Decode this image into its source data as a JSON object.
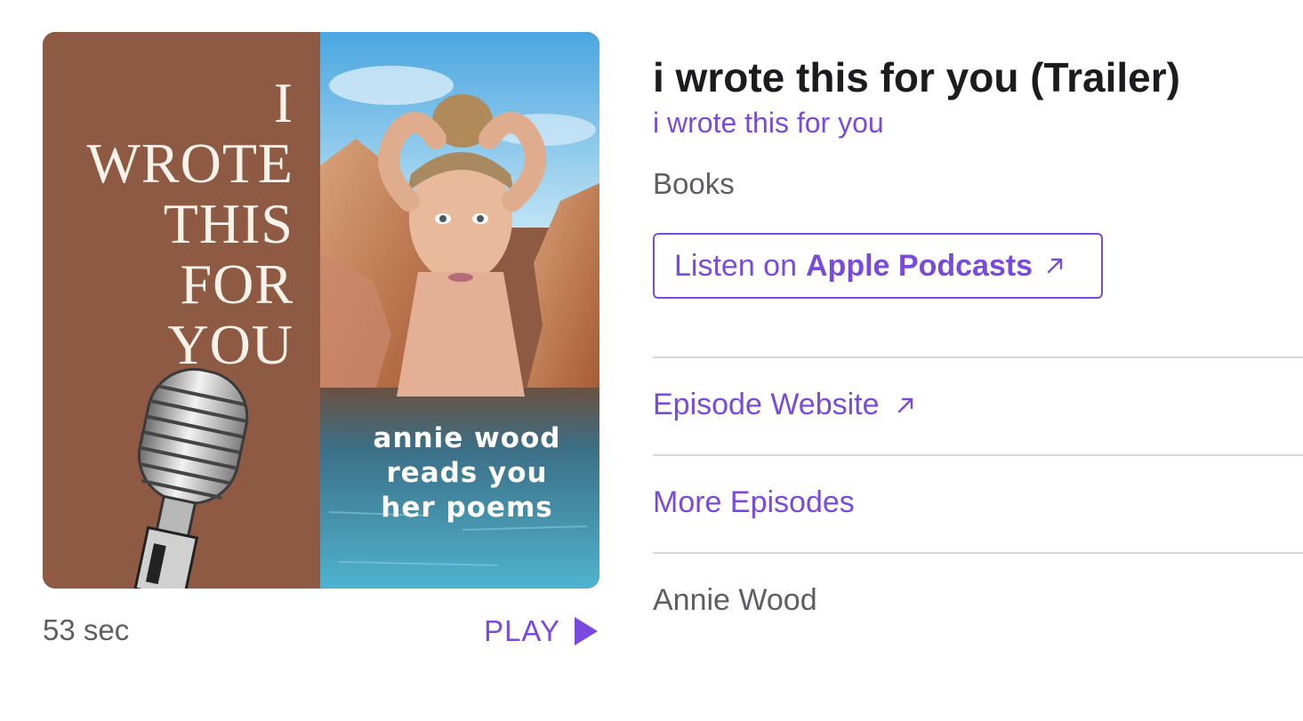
{
  "artwork": {
    "title_lines": [
      "I",
      "WROTE",
      "THIS",
      "FOR",
      "YOU"
    ],
    "subtitle_lines": [
      "annie wood",
      "reads you",
      "her poems"
    ],
    "background_color": "#8f5a43"
  },
  "player": {
    "duration": "53 sec",
    "play_label": "PLAY",
    "play_icon": "play-triangle-icon"
  },
  "episode": {
    "title": "i wrote this for you (Trailer)",
    "show_name": "i wrote this for you",
    "category": "Books",
    "author": "Annie Wood"
  },
  "listen_button": {
    "prefix": "Listen on",
    "brand": "Apple Podcasts",
    "icon": "external-arrow-icon"
  },
  "links": {
    "episode_website": "Episode Website",
    "more_episodes": "More Episodes"
  },
  "colors": {
    "accent": "#7a4ae0",
    "title": "#1c1c1e",
    "secondary_text": "#5e5e62",
    "divider": "#d8d8dc"
  }
}
